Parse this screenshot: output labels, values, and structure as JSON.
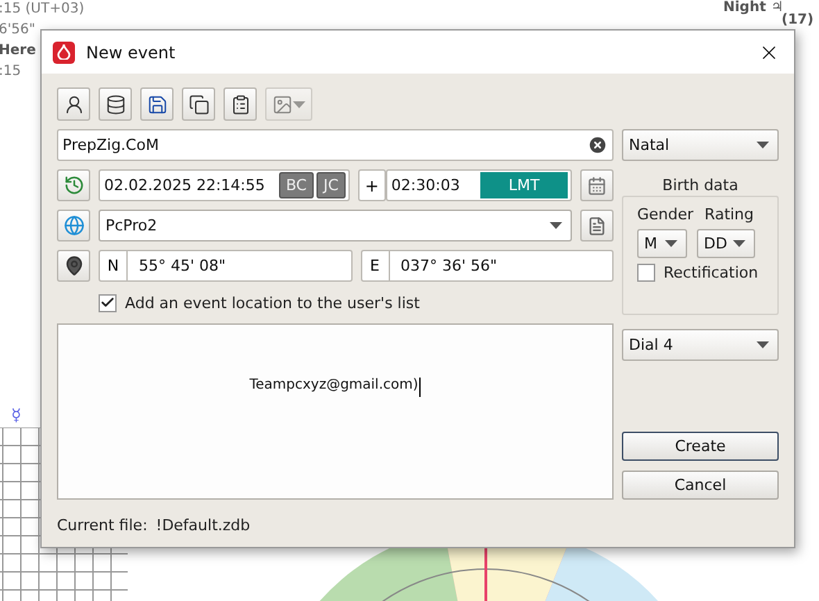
{
  "background": {
    "left_texts": [
      ":15 (UT+03)",
      "6'56\"",
      "Here",
      ":15"
    ],
    "right_texts": [
      "Night ♃",
      "(17)"
    ],
    "glyph": "☿"
  },
  "window": {
    "title": "New event"
  },
  "toolbar": [
    {
      "kind": "new-person",
      "disabled": false
    },
    {
      "kind": "database",
      "disabled": false
    },
    {
      "kind": "save",
      "disabled": false
    },
    {
      "kind": "copy",
      "disabled": false
    },
    {
      "kind": "paste",
      "disabled": false
    },
    {
      "kind": "image",
      "disabled": true
    }
  ],
  "name_field": {
    "value": "PrepZig.CoM"
  },
  "chart_type": {
    "value": "Natal"
  },
  "datetime": {
    "value": "02.02.2025 22:14:55",
    "era_buttons": [
      "BC",
      "JC"
    ]
  },
  "offset": {
    "sign": "+",
    "value": "02:30:03",
    "zone": "LMT"
  },
  "birth_data": {
    "title": "Birth data",
    "gender": {
      "label": "Gender",
      "value": "M"
    },
    "rating": {
      "label": "Rating",
      "value": "DD"
    },
    "rectification": {
      "label": "Rectification",
      "checked": false
    }
  },
  "place": {
    "value": "PcPro2"
  },
  "coordinates": [
    {
      "hemisphere": "N",
      "value": "55° 45' 08\""
    },
    {
      "hemisphere": "E",
      "value": "037° 36' 56\""
    }
  ],
  "add_location": {
    "label": "Add an event location to the user's list",
    "checked": true
  },
  "notes": {
    "value": "Teampcxyz@gmail.com)"
  },
  "dial": {
    "value": "Dial 4"
  },
  "buttons": [
    {
      "label": "Create",
      "default": true
    },
    {
      "label": "Cancel",
      "default": false
    }
  ],
  "current_file": {
    "label": "Current file:",
    "value": "!Default.zdb"
  }
}
